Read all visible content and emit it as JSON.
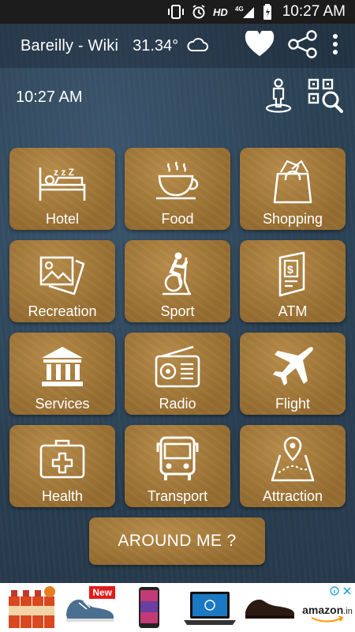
{
  "status_bar": {
    "network": "HD",
    "signal_label": "4G",
    "time": "10:27 AM"
  },
  "app_bar": {
    "title": "Bareilly - Wiki",
    "temperature": "31.34°"
  },
  "clock": {
    "time": "10:27 AM"
  },
  "categories": [
    {
      "label": "Hotel",
      "icon": "bed-icon"
    },
    {
      "label": "Food",
      "icon": "coffee-cup-icon"
    },
    {
      "label": "Shopping",
      "icon": "shopping-bag-icon"
    },
    {
      "label": "Recreation",
      "icon": "photos-icon"
    },
    {
      "label": "Sport",
      "icon": "exercise-bike-icon"
    },
    {
      "label": "ATM",
      "icon": "atm-icon"
    },
    {
      "label": "Services",
      "icon": "bank-building-icon"
    },
    {
      "label": "Radio",
      "icon": "radio-icon"
    },
    {
      "label": "Flight",
      "icon": "airplane-icon"
    },
    {
      "label": "Health",
      "icon": "first-aid-kit-icon"
    },
    {
      "label": "Transport",
      "icon": "bus-icon"
    },
    {
      "label": "Attraction",
      "icon": "map-pin-icon"
    }
  ],
  "around_button": {
    "label": "AROUND ME ?"
  },
  "ad": {
    "badge_new": "New",
    "brand": "amazon",
    "brand_suffix": ".in"
  },
  "colors": {
    "tile": "#a57a3c",
    "background": "#2c4559",
    "status_bar": "#1c1c1c"
  }
}
